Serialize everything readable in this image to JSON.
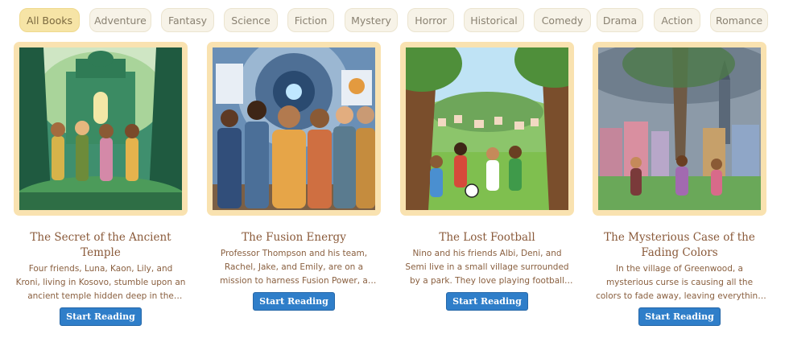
{
  "filters": [
    {
      "label": "All Books",
      "active": true
    },
    {
      "label": "Adventure",
      "active": false
    },
    {
      "label": "Fantasy",
      "active": false
    },
    {
      "label": "Science",
      "active": false
    },
    {
      "label": "Fiction",
      "active": false
    },
    {
      "label": "Mystery",
      "active": false
    },
    {
      "label": "Horror",
      "active": false
    },
    {
      "label": "Historical",
      "active": false
    },
    {
      "label": "Comedy",
      "active": false
    },
    {
      "label": "Drama",
      "active": false
    },
    {
      "label": "Action",
      "active": false
    },
    {
      "label": "Romance",
      "active": false
    }
  ],
  "books": [
    {
      "title": "The Secret of the Ancient Temple",
      "description": "Four friends, Luna, Kaon, Lily, and Kroni, living in Kosovo, stumble upon an ancient temple hidden deep in the forest. As they…",
      "button": "Start Reading"
    },
    {
      "title": "The Fusion Energy",
      "description": "Professor Thompson and his team, Rachel, Jake, and Emily, are on a mission to harness Fusion Power, a revolutionary cle…",
      "button": "Start Reading"
    },
    {
      "title": "The Lost Football",
      "description": "Nino and his friends Albi, Deni, and Semi live in a small village surrounded by a park. They love playing football together. One…",
      "button": "Start Reading"
    },
    {
      "title": "The Mysterious Case of the Fading Colors",
      "description": "In the village of Greenwood, a mysterious curse is causing all the colors to fade away, leaving everything gray and dull. Three…",
      "button": "Start Reading"
    }
  ]
}
